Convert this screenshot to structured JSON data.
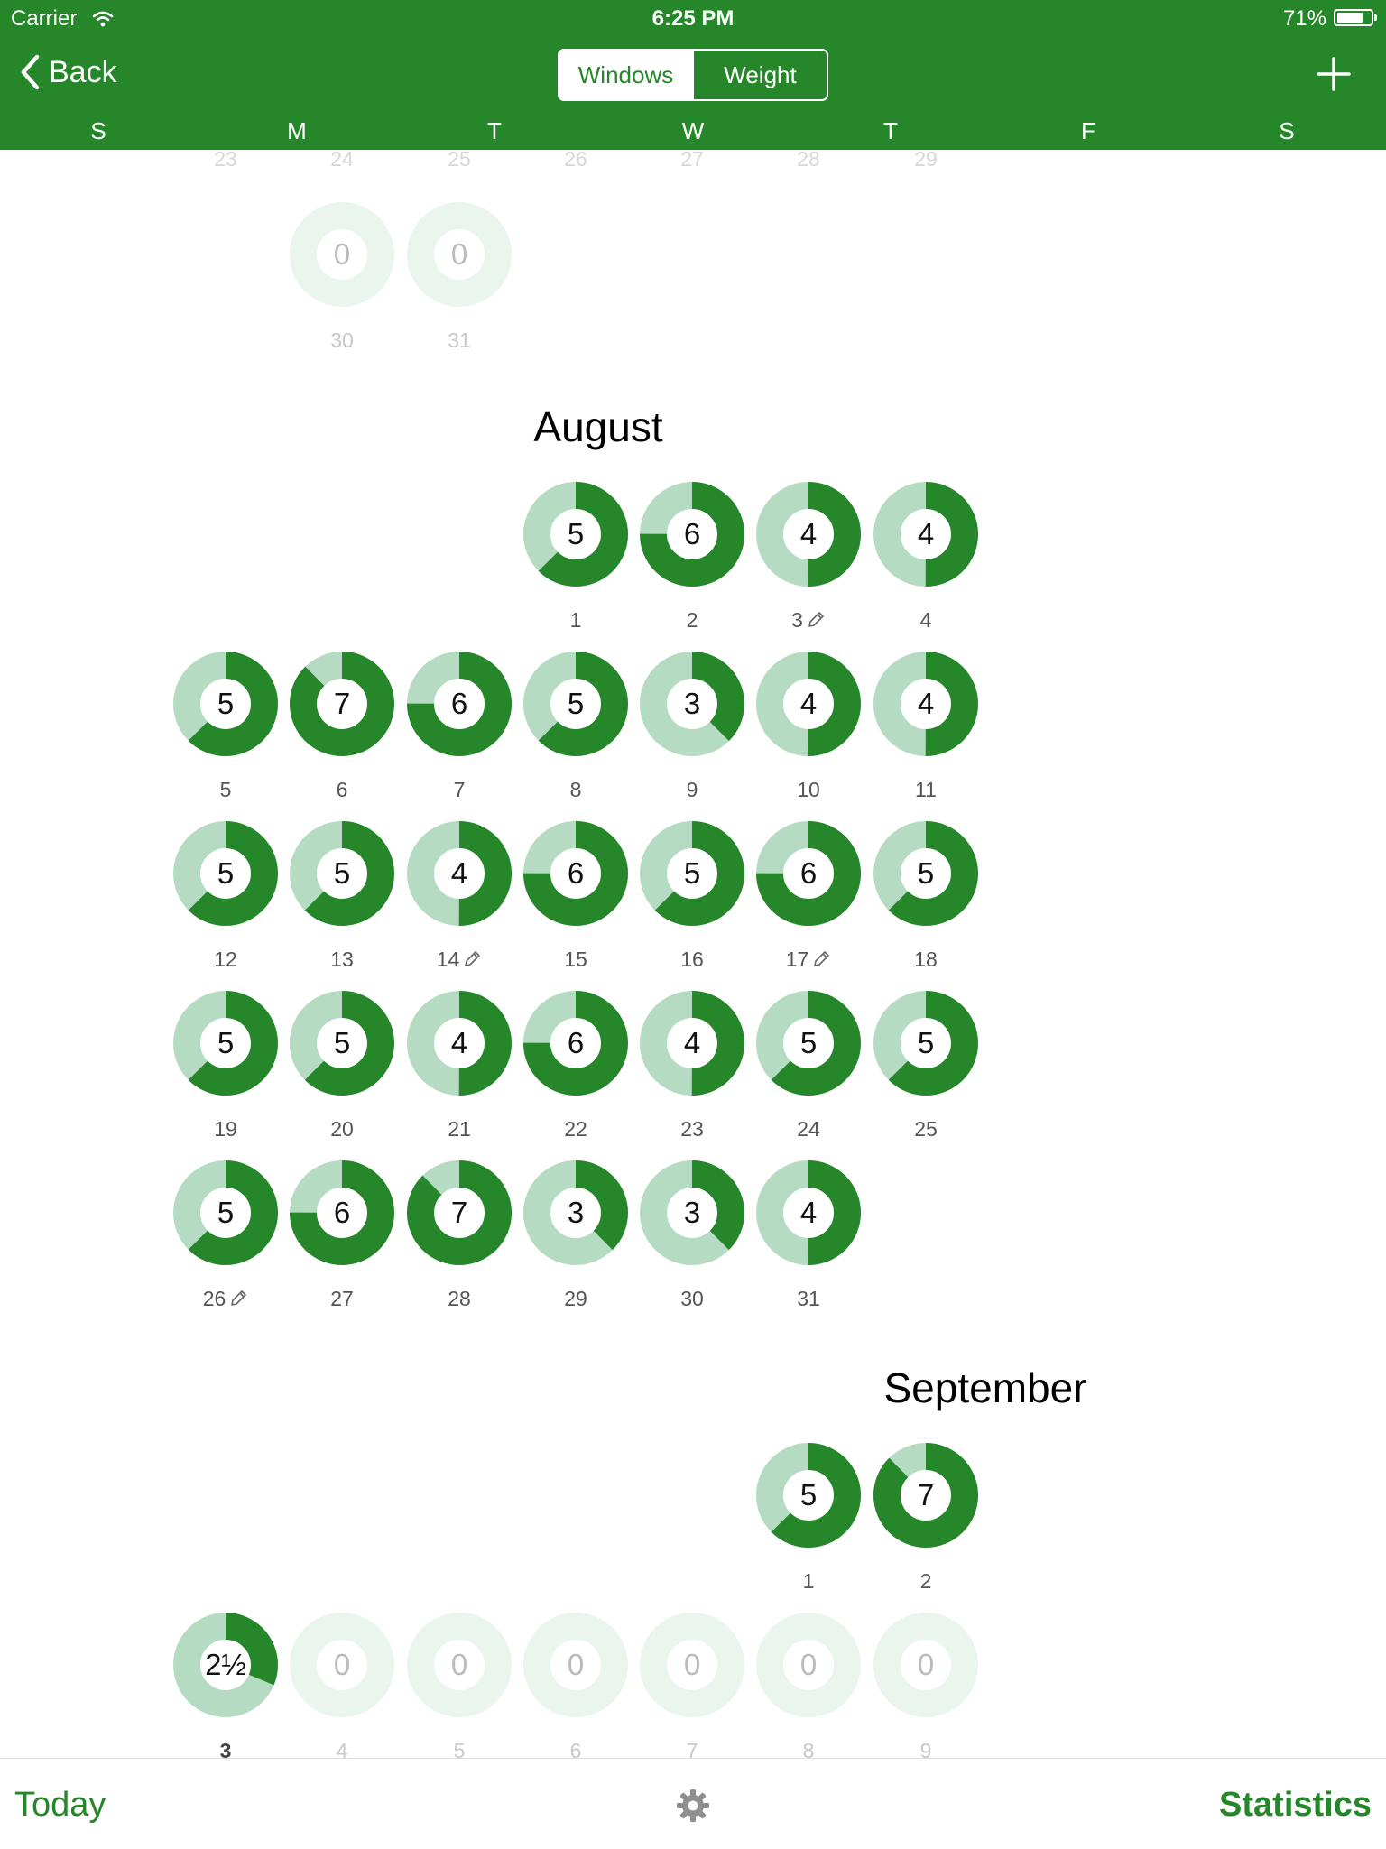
{
  "status_bar": {
    "carrier": "Carrier",
    "time": "6:25 PM",
    "battery": "71%",
    "battery_level": 0.71
  },
  "nav": {
    "back_label": "Back",
    "segments": [
      "Windows",
      "Weight"
    ],
    "selected_segment": "Windows",
    "add_icon": "plus-icon"
  },
  "weekdays": [
    "S",
    "M",
    "T",
    "W",
    "T",
    "F",
    "S"
  ],
  "colors": {
    "brand_green": "#25862a",
    "ring_track": "#b5dcc3",
    "ring_track_empty": "#eaf5ee"
  },
  "ring_max": 8,
  "calendar": {
    "prev_month_tail": {
      "top_numbers": [
        "23",
        "24",
        "25",
        "26",
        "27",
        "28",
        "29"
      ],
      "days": [
        {
          "label": "30",
          "value": "0",
          "dow": 1
        },
        {
          "label": "31",
          "value": "0",
          "dow": 2
        }
      ]
    },
    "august": {
      "title": "August",
      "days": [
        {
          "label": "1",
          "value": "5",
          "edited": false
        },
        {
          "label": "2",
          "value": "6",
          "edited": false
        },
        {
          "label": "3",
          "value": "4",
          "edited": true
        },
        {
          "label": "4",
          "value": "4",
          "edited": false
        },
        {
          "label": "5",
          "value": "5",
          "edited": false
        },
        {
          "label": "6",
          "value": "7",
          "edited": false
        },
        {
          "label": "7",
          "value": "6",
          "edited": false
        },
        {
          "label": "8",
          "value": "5",
          "edited": false
        },
        {
          "label": "9",
          "value": "3",
          "edited": false
        },
        {
          "label": "10",
          "value": "4",
          "edited": false
        },
        {
          "label": "11",
          "value": "4",
          "edited": false
        },
        {
          "label": "12",
          "value": "5",
          "edited": false
        },
        {
          "label": "13",
          "value": "5",
          "edited": false
        },
        {
          "label": "14",
          "value": "4",
          "edited": true
        },
        {
          "label": "15",
          "value": "6",
          "edited": false
        },
        {
          "label": "16",
          "value": "5",
          "edited": false
        },
        {
          "label": "17",
          "value": "6",
          "edited": true
        },
        {
          "label": "18",
          "value": "5",
          "edited": false
        },
        {
          "label": "19",
          "value": "5",
          "edited": false
        },
        {
          "label": "20",
          "value": "5",
          "edited": false
        },
        {
          "label": "21",
          "value": "4",
          "edited": false
        },
        {
          "label": "22",
          "value": "6",
          "edited": false
        },
        {
          "label": "23",
          "value": "4",
          "edited": false
        },
        {
          "label": "24",
          "value": "5",
          "edited": false
        },
        {
          "label": "25",
          "value": "5",
          "edited": false
        },
        {
          "label": "26",
          "value": "5",
          "edited": true
        },
        {
          "label": "27",
          "value": "6",
          "edited": false
        },
        {
          "label": "28",
          "value": "7",
          "edited": false
        },
        {
          "label": "29",
          "value": "3",
          "edited": false
        },
        {
          "label": "30",
          "value": "3",
          "edited": false
        },
        {
          "label": "31",
          "value": "4",
          "edited": false
        }
      ]
    },
    "september": {
      "title": "September",
      "days": [
        {
          "label": "1",
          "value": "5"
        },
        {
          "label": "2",
          "value": "7"
        },
        {
          "label": "3",
          "value": "2½",
          "today": true
        },
        {
          "label": "4",
          "value": "0",
          "future": true
        },
        {
          "label": "5",
          "value": "0",
          "future": true
        },
        {
          "label": "6",
          "value": "0",
          "future": true
        },
        {
          "label": "7",
          "value": "0",
          "future": true
        },
        {
          "label": "8",
          "value": "0",
          "future": true
        },
        {
          "label": "9",
          "value": "0",
          "future": true
        }
      ]
    }
  },
  "tab_bar": {
    "today_label": "Today",
    "settings_icon": "gear-icon",
    "statistics_label": "Statistics"
  }
}
